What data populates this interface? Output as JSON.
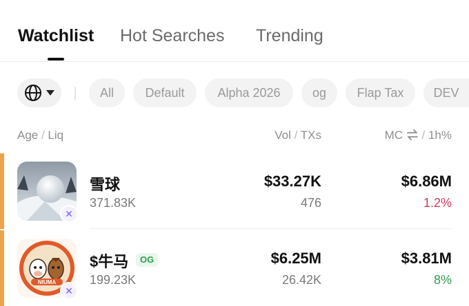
{
  "tabs": [
    {
      "label": "Watchlist",
      "active": true
    },
    {
      "label": "Hot Searches",
      "active": false
    },
    {
      "label": "Trending",
      "active": false
    }
  ],
  "filters": {
    "chain_icon": "globe-icon",
    "chips": [
      "All",
      "Default",
      "Alpha 2026",
      "og",
      "Flap Tax",
      "DEV"
    ]
  },
  "columns": {
    "age": "Age",
    "liq": "Liq",
    "vol": "Vol",
    "txs": "TXs",
    "mc": "MC",
    "mc_toggle_icon": "swap-arrows-icon",
    "change": "1h%"
  },
  "rows": [
    {
      "name": "雪球",
      "badge": "",
      "liquidity": "371.83K",
      "volume": "$33.27K",
      "txs": "476",
      "market_cap": "$6.86M",
      "change": "1.2%",
      "change_color": "#d0395a",
      "chain_icon": "butterfly-icon"
    },
    {
      "name": "$牛马",
      "badge": "OG",
      "liquidity": "199.23K",
      "volume": "$6.25M",
      "txs": "26.42K",
      "market_cap": "$3.81M",
      "change": "8%",
      "change_color": "#2f9c4f",
      "chain_icon": "butterfly-icon",
      "logo_text": "NIUMA"
    }
  ],
  "colors": {
    "accent": "#f0a24a",
    "negative": "#d0395a",
    "positive": "#2f9c4f"
  }
}
